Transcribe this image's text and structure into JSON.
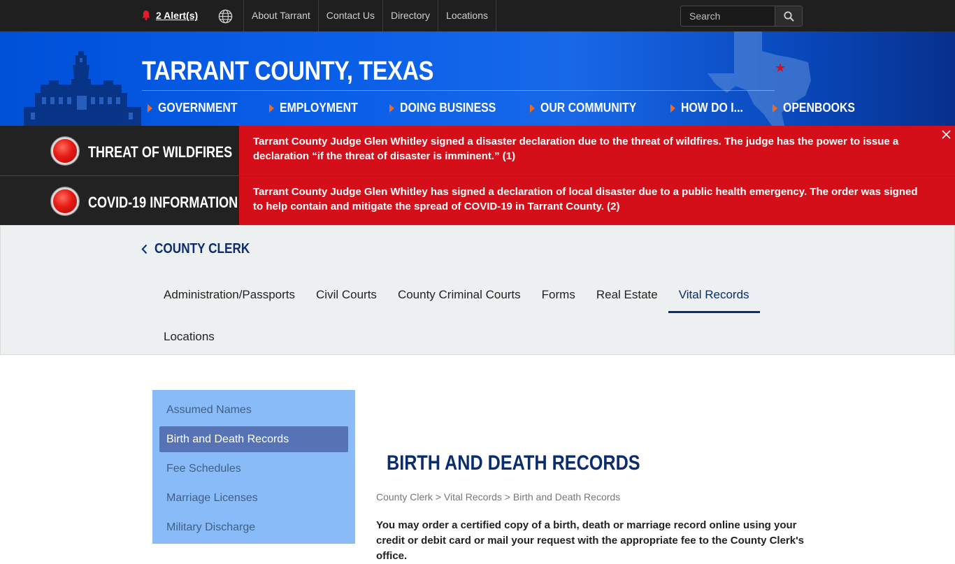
{
  "topbar": {
    "alerts_label": "2 Alert(s)",
    "links": [
      "About Tarrant",
      "Contact Us",
      "Directory",
      "Locations"
    ],
    "search_placeholder": "Search"
  },
  "header": {
    "title": "TARRANT COUNTY, TEXAS",
    "nav": [
      "GOVERNMENT",
      "EMPLOYMENT",
      "DOING BUSINESS",
      "OUR COMMUNITY",
      "HOW DO I...",
      "OPENBOOKS"
    ]
  },
  "alerts": [
    {
      "title": "THREAT OF WILDFIRES",
      "text": "Tarrant County Judge Glen Whitley signed a disaster declaration due to the threat of wildfires. The judge has the power to issue a declaration “if the threat of disaster is imminent.” (1)"
    },
    {
      "title": "COVID-19 INFORMATION",
      "text": "Tarrant County Judge Glen Whitley has signed a declaration of local disaster due to a public health emergency. The order was signed to help contain and mitigate the spread of COVID-19 in Tarrant County. (2)"
    }
  ],
  "dept": {
    "title": "COUNTY CLERK",
    "tabs": [
      "Administration/Passports",
      "Civil Courts",
      "County Criminal Courts",
      "Forms",
      "Real Estate",
      "Vital Records",
      "Locations"
    ],
    "active_tab": "Vital Records"
  },
  "sidebar": {
    "items": [
      "Assumed Names",
      "Birth and Death Records",
      "Fee Schedules",
      "Marriage Licenses",
      "Military Discharge"
    ],
    "active_item": "Birth and Death Records"
  },
  "content": {
    "heading": "BIRTH AND DEATH RECORDS",
    "breadcrumb": [
      "County Clerk",
      "Vital Records",
      "Birth and Death Records"
    ],
    "breadcrumb_sep": " > ",
    "intro": "You may order a certified copy of a birth, death or marriage record online using your credit or debit card or mail your request with the appropriate fee to the County Clerk's office."
  },
  "colors": {
    "brand_blue": "#0c2d6b",
    "alert_red": "#d40f19",
    "nav_arrow": "#f26a1b",
    "sidebar_bg": "#88bbf8"
  }
}
